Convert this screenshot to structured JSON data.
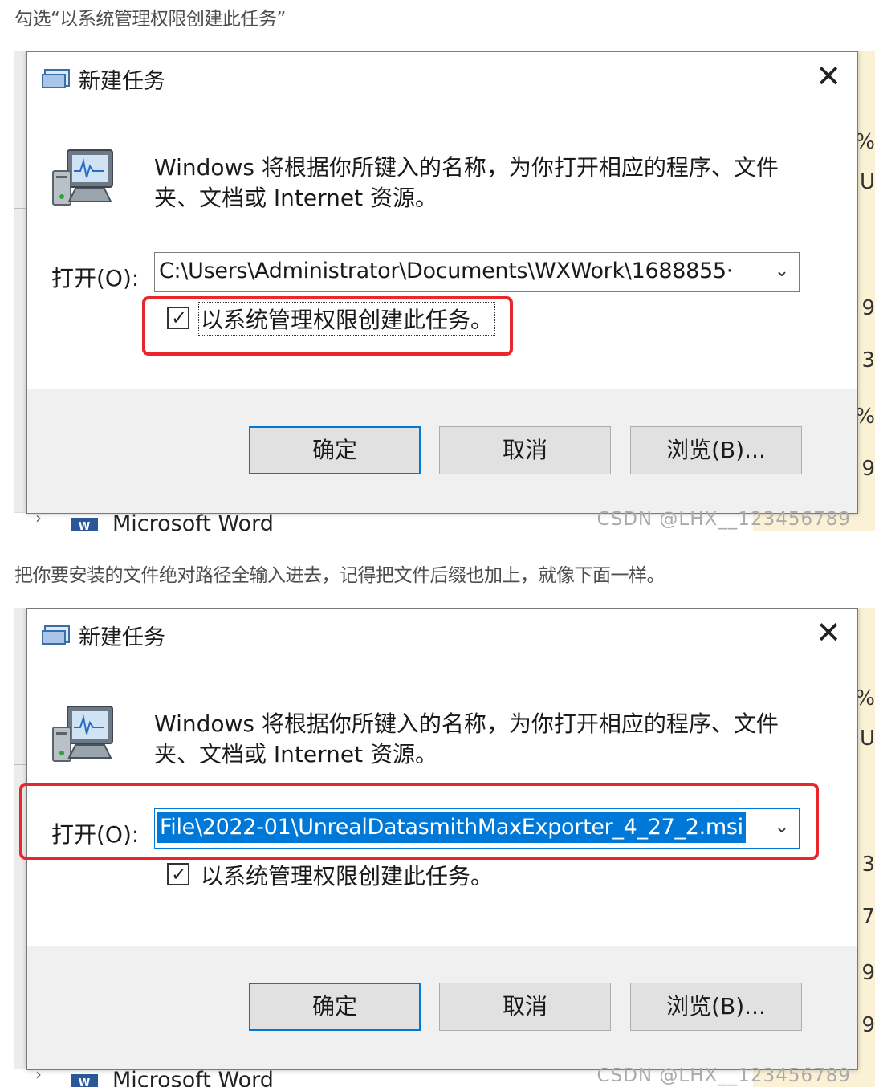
{
  "captions": [
    "勾选“以系统管理权限创建此任务”",
    "把你要安装的文件绝对路径全输入进去，记得把文件后缀也加上，就像下面一样。"
  ],
  "dialogs": [
    {
      "title": "新建任务",
      "description": "Windows 将根据你所键入的名称，为你打开相应的程序、文件夹、文档或 Internet 资源。",
      "open_label": "打开(O):",
      "open_value": "C:\\Users\\Administrator\\Documents\\WXWork\\1688855·",
      "checkbox_label": "以系统管理权限创建此任务。",
      "checkbox_checked": true,
      "buttons": {
        "ok": "确定",
        "cancel": "取消",
        "browse": "浏览(B)..."
      },
      "watermark": "CSDN @LHX__123456789",
      "background": {
        "word_label": "Microsoft Word",
        "word_icon": "W"
      }
    },
    {
      "title": "新建任务",
      "description": "Windows 将根据你所键入的名称，为你打开相应的程序、文件夹、文档或 Internet 资源。",
      "open_label": "打开(O):",
      "open_value": "File\\2022-01\\UnrealDatasmithMaxExporter_4_27_2.msi",
      "checkbox_label": "以系统管理权限创建此任务。",
      "checkbox_checked": true,
      "buttons": {
        "ok": "确定",
        "cancel": "取消",
        "browse": "浏览(B)..."
      },
      "watermark": "CSDN @LHX__123456789",
      "background": {
        "word_label": "Microsoft Word",
        "word_icon": "W"
      }
    }
  ],
  "colors": {
    "highlight_red": "#e8262b",
    "selection_blue": "#0078d7"
  }
}
